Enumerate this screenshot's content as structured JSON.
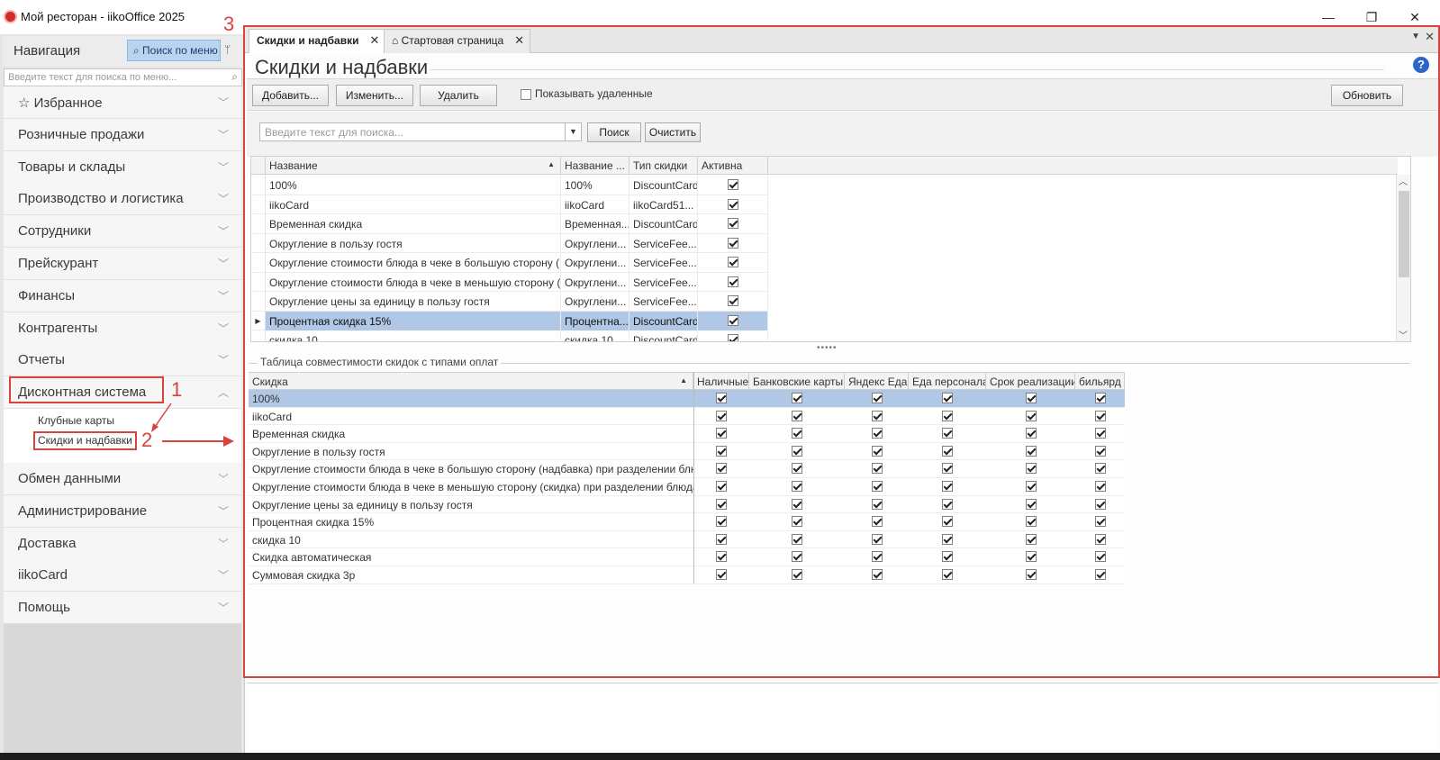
{
  "window": {
    "title": "Мой ресторан - iikoOffice 2025",
    "minimize": "—",
    "restore": "❐",
    "close": "✕"
  },
  "navigation": {
    "title": "Навигация",
    "search_button": "⌕ Поиск по меню",
    "pin": "ᛘ",
    "search_placeholder": "Введите текст для поиска по меню...",
    "search_icon": "⌕",
    "items_top": [
      {
        "label": "☆ Избранное",
        "chevron": "﹀"
      },
      {
        "label": "Розничные продажи",
        "chevron": "﹀"
      },
      {
        "label": "Товары и склады",
        "chevron": "﹀"
      },
      {
        "label": "Производство и логистика",
        "chevron": "﹀"
      },
      {
        "label": "Сотрудники",
        "chevron": "﹀"
      },
      {
        "label": "Прейскурант",
        "chevron": "﹀"
      },
      {
        "label": "Финансы",
        "chevron": "﹀"
      },
      {
        "label": "Контрагенты",
        "chevron": "﹀"
      },
      {
        "label": "Отчеты",
        "chevron": "﹀"
      },
      {
        "label": "Дисконтная система",
        "chevron": "︿"
      }
    ],
    "sub_items": [
      "Клубные карты",
      "Скидки и надбавки"
    ],
    "items_bottom": [
      {
        "label": "Обмен данными",
        "chevron": "﹀"
      },
      {
        "label": "Администрирование",
        "chevron": "﹀"
      },
      {
        "label": "Доставка",
        "chevron": "﹀"
      },
      {
        "label": "iikoCard",
        "chevron": "﹀"
      },
      {
        "label": "Помощь",
        "chevron": "﹀"
      }
    ]
  },
  "annotations": {
    "n1": "1",
    "n2": "2",
    "n3": "3",
    "accent": "#d9423e"
  },
  "tabs": [
    {
      "label": "Скидки и надбавки",
      "close": "✕",
      "active": true
    },
    {
      "label": "⌂ Стартовая страница",
      "close": "✕",
      "active": false
    }
  ],
  "tabbar": {
    "menu": "▼",
    "close": "✕"
  },
  "page": {
    "title": "Скидки и надбавки",
    "help": "?"
  },
  "toolbar": {
    "add": "Добавить...",
    "edit": "Изменить...",
    "delete": "Удалить",
    "show_deleted": "Показывать удаленные",
    "refresh": "Обновить"
  },
  "search": {
    "placeholder": "Введите текст для поиска...",
    "dropdown": "▼",
    "find": "Поиск",
    "clear": "Очистить"
  },
  "grid1": {
    "columns": [
      "Название",
      "Название ...",
      "Тип скидки",
      "Активна"
    ],
    "sort_icon": "▲",
    "rows": [
      {
        "name": "100%",
        "short": "100%",
        "type": "DiscountCard",
        "active": true
      },
      {
        "name": "iikoCard",
        "short": "iikoCard",
        "type": "iikoCard51...",
        "active": true
      },
      {
        "name": "Временная скидка",
        "short": "Временная...",
        "type": "DiscountCard",
        "active": true
      },
      {
        "name": "Округление в пользу гостя",
        "short": "Округлени...",
        "type": "ServiceFee...",
        "active": true
      },
      {
        "name": "Округление стоимости блюда в чеке в большую сторону (...",
        "short": "Округлени...",
        "type": "ServiceFee...",
        "active": true
      },
      {
        "name": "Округление стоимости блюда в чеке в меньшую сторону (...",
        "short": "Округлени...",
        "type": "ServiceFee...",
        "active": true
      },
      {
        "name": "Округление цены за единицу в пользу гостя",
        "short": "Округлени...",
        "type": "ServiceFee...",
        "active": true
      },
      {
        "name": "Процентная скидка 15%",
        "short": "Процентна...",
        "type": "DiscountCard",
        "active": true,
        "selected": true
      },
      {
        "name": "скидка 10",
        "short": "скидка 10",
        "type": "DiscountCard",
        "active": true
      }
    ],
    "row_indicator": "▶",
    "scroll_up": "︿",
    "scroll_down": "﹀",
    "splitter": "•••••"
  },
  "compat": {
    "group_title": "Таблица совместимости скидок с типами оплат",
    "columns": [
      "Скидка",
      "Наличные",
      "Банковские карты",
      "Яндекс Еда",
      "Еда персонала",
      "Срок реализации",
      "бильярд"
    ],
    "sort_icon": "▲",
    "rows": [
      "100%",
      "iikoCard",
      "Временная скидка",
      "Округление в пользу гостя",
      "Округление стоимости блюда в чеке в большую сторону (надбавка) при разделении блюда",
      "Округление стоимости блюда в чеке в меньшую сторону (скидка) при разделении блюда",
      "Округление цены за единицу в пользу гостя",
      "Процентная скидка 15%",
      "скидка 10",
      "Скидка автоматическая",
      "Суммовая скидка 3р"
    ],
    "all_checked": true
  }
}
